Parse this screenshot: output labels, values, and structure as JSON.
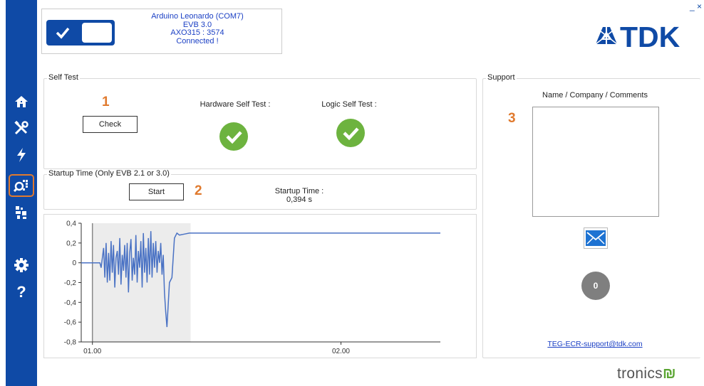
{
  "connection": {
    "device": "Arduino Leonardo (COM7)",
    "evb": "EVB 3.0",
    "axo": "AXO315 : 3574",
    "status": "Connected !",
    "toggle_on": true
  },
  "brand": {
    "logo": "TDK",
    "footer_logo": "tronics",
    "footer_mark": "₪"
  },
  "window": {
    "minimize": "_",
    "close": "×"
  },
  "sidebar": {
    "items": [
      {
        "name": "home-icon"
      },
      {
        "name": "tools-icon"
      },
      {
        "name": "lightning-icon"
      },
      {
        "name": "search-analysis-icon",
        "active": true
      },
      {
        "name": "qr-module-icon"
      },
      {
        "name": "settings-icon"
      },
      {
        "name": "help-icon",
        "glyph": "?"
      }
    ]
  },
  "self_test": {
    "title": "Self Test",
    "check_label": "Check",
    "hardware_label": "Hardware Self Test :",
    "logic_label": "Logic Self Test :",
    "hardware_ok": true,
    "logic_ok": true
  },
  "startup": {
    "title": "Startup Time (Only EVB 2.1 or 3.0)",
    "start_label": "Start",
    "time_label": "Startup Time :",
    "time_value": "0,394 s"
  },
  "support": {
    "title": "Support",
    "field_label": "Name / Company / Comments",
    "textarea_value": "",
    "count": "0",
    "email": "TEG-ECR-support@tdk.com"
  },
  "annotations": [
    "1",
    "2",
    "3"
  ],
  "colors": {
    "sidebar": "#0f4aa6",
    "accent_orange": "#e07a2e",
    "success_green": "#6db33f",
    "series_line": "#4a72c4",
    "link_blue": "#1a3fc4"
  },
  "chart_data": {
    "type": "line",
    "x_tick_labels": [
      "01.00",
      "02.00"
    ],
    "y_ticks": [
      0.4,
      0.2,
      0,
      -0.2,
      -0.4,
      -0.6,
      -0.8
    ],
    "y_tick_labels": [
      "0,4",
      "0,2",
      "0",
      "-0,2",
      "-0,4",
      "-0,6",
      "-0,8"
    ],
    "ylim": [
      -0.8,
      0.4
    ],
    "xlim": [
      0.955,
      2.4
    ],
    "highlight_range": [
      1.0,
      1.395
    ],
    "grid": false,
    "series": [
      {
        "x": [
          0.955,
          0.995,
          1.0,
          1.03,
          1.035,
          1.045,
          1.05,
          1.055,
          1.06,
          1.065,
          1.07,
          1.075,
          1.08,
          1.085,
          1.09,
          1.095,
          1.1,
          1.105,
          1.11,
          1.115,
          1.12,
          1.125,
          1.13,
          1.135,
          1.14,
          1.145,
          1.15,
          1.155,
          1.16,
          1.165,
          1.17,
          1.175,
          1.18,
          1.185,
          1.19,
          1.195,
          1.2,
          1.205,
          1.21,
          1.215,
          1.22,
          1.225,
          1.23,
          1.235,
          1.24,
          1.245,
          1.25,
          1.255,
          1.26,
          1.265,
          1.27,
          1.275,
          1.28,
          1.285,
          1.29,
          1.295,
          1.3,
          1.31,
          1.32,
          1.33,
          1.34,
          1.35,
          1.37,
          1.39,
          1.395,
          1.5,
          1.7,
          1.9,
          2.1,
          2.3,
          2.4
        ],
        "y": [
          0.0,
          0.0,
          0.0,
          0.0,
          -0.05,
          0.15,
          -0.15,
          0.2,
          -0.2,
          0.1,
          -0.18,
          0.22,
          -0.1,
          0.18,
          -0.25,
          0.05,
          0.12,
          -0.12,
          0.25,
          -0.22,
          0.08,
          -0.08,
          0.18,
          -0.15,
          0.2,
          -0.3,
          0.1,
          0.24,
          -0.18,
          0.05,
          -0.12,
          0.28,
          -0.2,
          0.12,
          -0.05,
          0.22,
          -0.25,
          0.3,
          -0.1,
          0.15,
          -0.2,
          0.25,
          -0.12,
          0.32,
          -0.15,
          0.2,
          -0.05,
          0.22,
          -0.1,
          0.12,
          0.0,
          0.2,
          -0.12,
          0.08,
          -0.3,
          -0.5,
          -0.65,
          -0.2,
          -0.15,
          0.25,
          0.3,
          0.28,
          0.29,
          0.3,
          0.3,
          0.3,
          0.3,
          0.3,
          0.3,
          0.3,
          0.3
        ]
      }
    ]
  }
}
